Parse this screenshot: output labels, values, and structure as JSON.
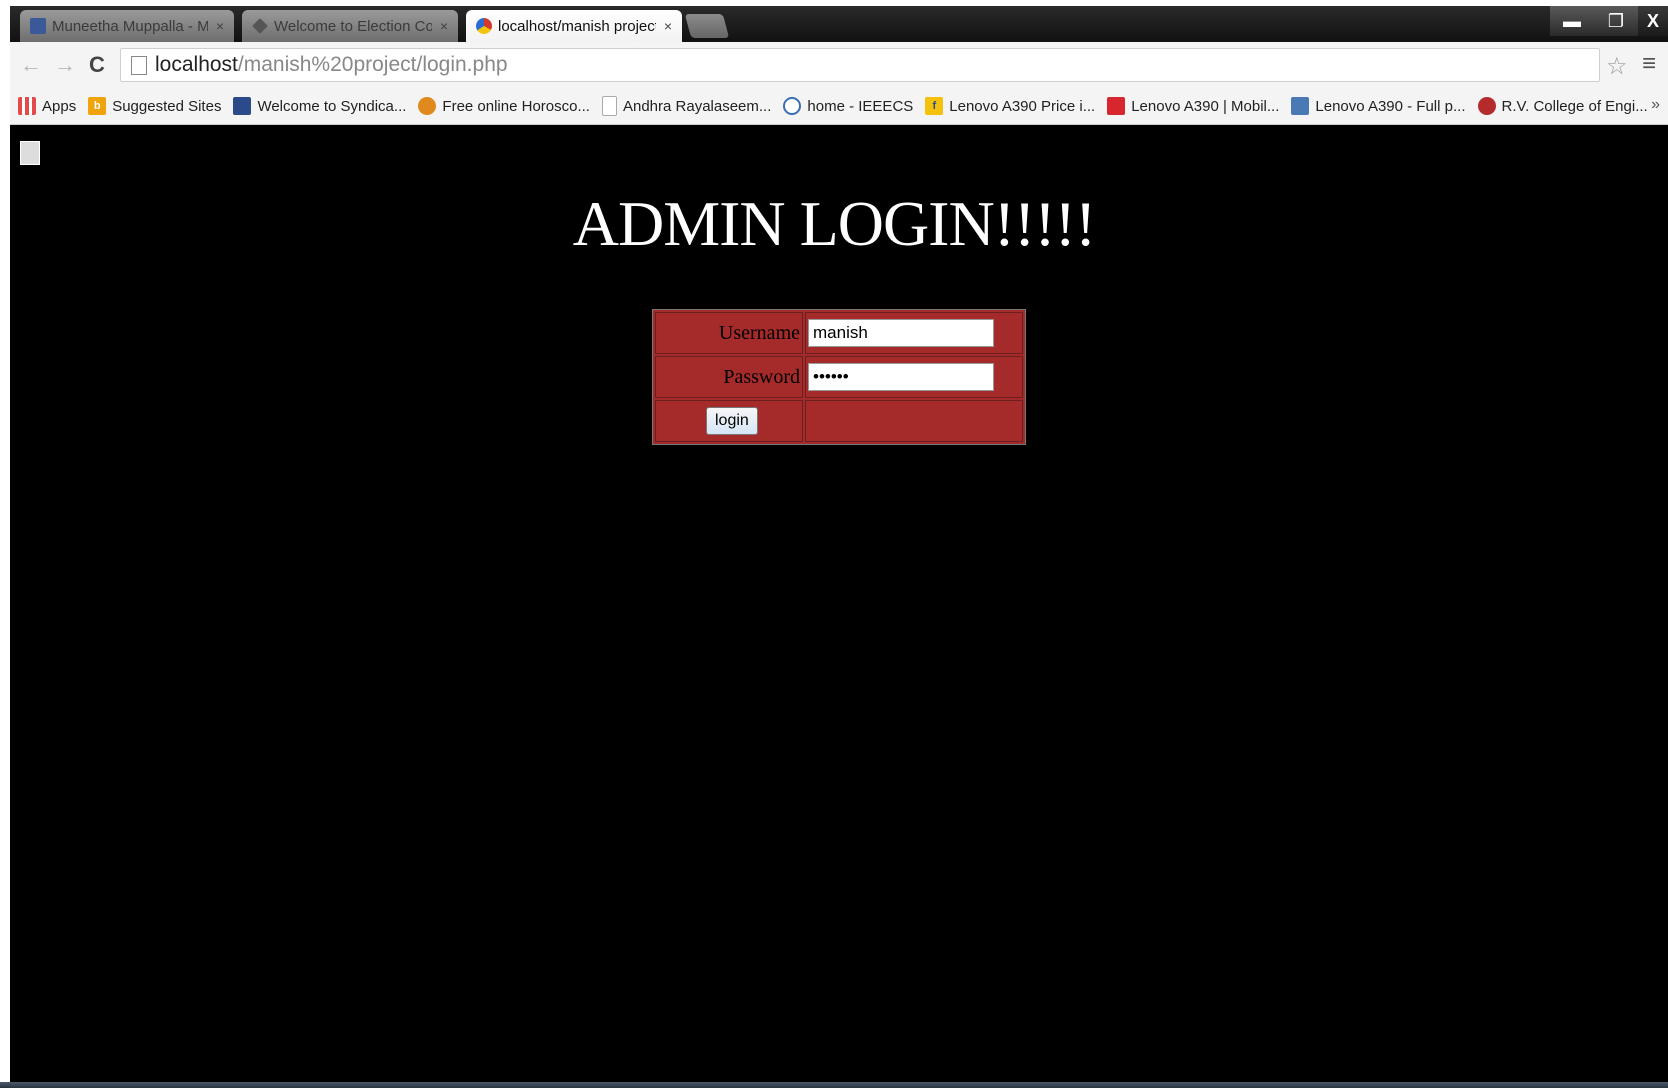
{
  "tabs": [
    {
      "title": "Muneetha Muppalla - M",
      "close": "×",
      "icon": "facebook-icon",
      "color": "#3b5998"
    },
    {
      "title": "Welcome to Election Com",
      "close": "×",
      "icon": "election-commission-icon",
      "color": "#555555"
    },
    {
      "title": "localhost/manish project/",
      "close": "×",
      "icon": "localhost-icon",
      "color": "#d23b2b",
      "active": true
    }
  ],
  "window_controls": {
    "minimize": "▬",
    "maximize": "❐",
    "close": "X"
  },
  "toolbar": {
    "back": "←",
    "forward": "→",
    "reload": "C",
    "url_host": "localhost",
    "url_path": "/manish%20project/login.php",
    "star": "☆",
    "menu": "≡"
  },
  "bookmarks": [
    {
      "label": "Apps",
      "icon": "apps-grid-icon",
      "color": "#e34b4b"
    },
    {
      "label": "Suggested Sites",
      "icon": "bing-icon",
      "color": "#f0a30a"
    },
    {
      "label": "Welcome to Syndica...",
      "icon": "syndicate-icon",
      "color": "#2b4a8a"
    },
    {
      "label": "Free online Horosco...",
      "icon": "horoscope-icon",
      "color": "#e08a1e"
    },
    {
      "label": "Andhra Rayalaseem...",
      "icon": "page-icon",
      "color": "#bbbbbb"
    },
    {
      "label": "home - IEEECS",
      "icon": "globe-icon",
      "color": "#3a6fb5"
    },
    {
      "label": "Lenovo A390 Price i...",
      "icon": "flipkart-icon",
      "color": "#f4c20d"
    },
    {
      "label": "Lenovo A390 | Mobil...",
      "icon": "gadgets-icon",
      "color": "#d8262f"
    },
    {
      "label": "Lenovo A390 - Full p...",
      "icon": "photo-icon",
      "color": "#4a7ab5"
    },
    {
      "label": "R.V. College of Engi...",
      "icon": "college-icon",
      "color": "#b52b2b"
    }
  ],
  "bookmarks_more": "»",
  "page": {
    "title": "ADMIN LOGIN!!!!!",
    "username_label": "Username",
    "username_value": "manish",
    "password_label": "Password",
    "password_value": "manish",
    "login_button": "login"
  },
  "colors": {
    "page_background": "#000000",
    "form_background": "#a52a2a",
    "title_color": "#ffffff"
  }
}
